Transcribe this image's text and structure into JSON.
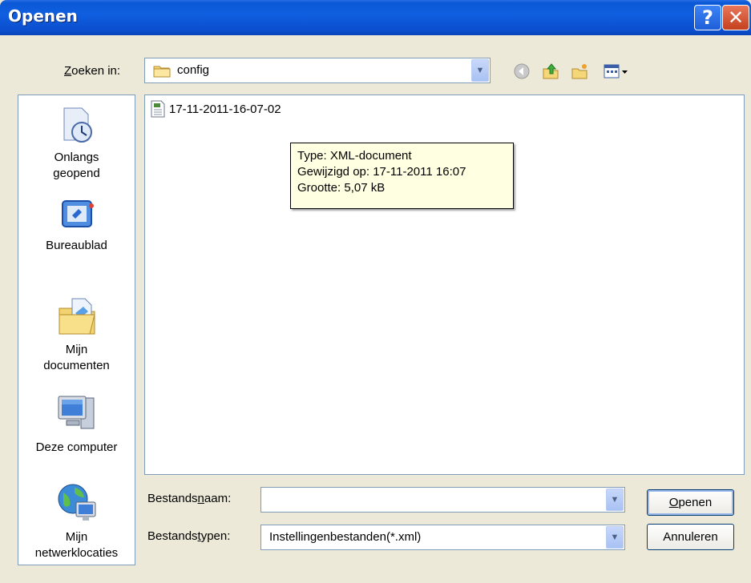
{
  "window": {
    "title": "Openen",
    "help_button": "?",
    "close_button": "✕"
  },
  "lookin": {
    "label_pre": "",
    "label_key": "Z",
    "label_post": "oeken in:",
    "value": "config"
  },
  "places": [
    {
      "line1": "Onlangs",
      "line2": "geopend",
      "icon": "recent-icon"
    },
    {
      "line1": "Bureaublad",
      "line2": "",
      "icon": "desktop-icon"
    },
    {
      "line1": "Mijn",
      "line2": "documenten",
      "icon": "my-documents-icon"
    },
    {
      "line1": "Deze computer",
      "line2": "",
      "icon": "my-computer-icon"
    },
    {
      "line1": "Mijn",
      "line2": "netwerklocaties",
      "icon": "network-places-icon"
    }
  ],
  "files": [
    {
      "name": "17-11-2011-16-07-02",
      "icon": "xml-file-icon"
    }
  ],
  "tooltip": {
    "line1": "Type: XML-document",
    "line2": "Gewijzigd op: 17-11-2011 16:07",
    "line3": "Grootte: 5,07 kB"
  },
  "filename": {
    "label_pre": "Bestands",
    "label_key": "n",
    "label_post": "aam:",
    "value": ""
  },
  "filetype": {
    "label_pre": "Bestands",
    "label_key": "t",
    "label_post": "ypen:",
    "value": "Instellingenbestanden(*.xml)"
  },
  "buttons": {
    "open_key": "O",
    "open_rest": "penen",
    "cancel": "Annuleren"
  }
}
